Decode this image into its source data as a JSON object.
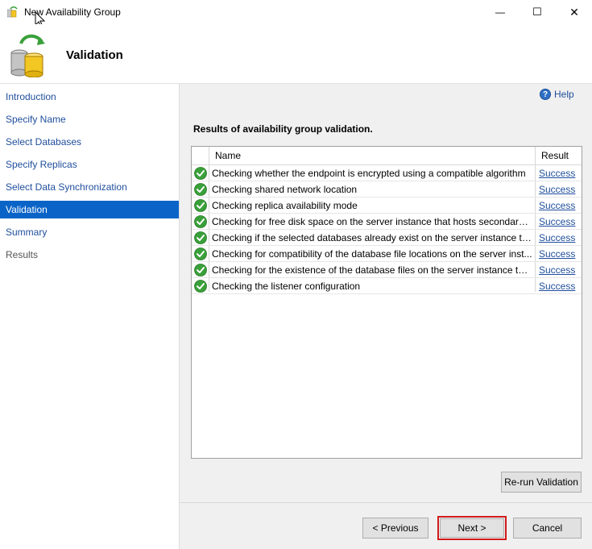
{
  "window": {
    "title": "New Availability Group",
    "minimize_symbol": "—",
    "maximize_symbol": "☐",
    "close_symbol": "✕"
  },
  "header": {
    "title": "Validation",
    "icon": "database-sync-icon"
  },
  "sidebar": {
    "items": [
      {
        "label": "Introduction",
        "state": "normal"
      },
      {
        "label": "Specify Name",
        "state": "normal"
      },
      {
        "label": "Select Databases",
        "state": "normal"
      },
      {
        "label": "Specify Replicas",
        "state": "normal"
      },
      {
        "label": "Select Data Synchronization",
        "state": "normal"
      },
      {
        "label": "Validation",
        "state": "selected"
      },
      {
        "label": "Summary",
        "state": "normal"
      },
      {
        "label": "Results",
        "state": "disabled"
      }
    ]
  },
  "main": {
    "help_label": "Help",
    "results_title": "Results of availability group validation.",
    "grid": {
      "columns": [
        "Name",
        "Result"
      ],
      "rows": [
        {
          "name": "Checking whether the endpoint is encrypted using a compatible algorithm",
          "result": "Success",
          "status_icon": "success-check-icon"
        },
        {
          "name": "Checking shared network location",
          "result": "Success",
          "status_icon": "success-check-icon"
        },
        {
          "name": "Checking replica availability mode",
          "result": "Success",
          "status_icon": "success-check-icon"
        },
        {
          "name": "Checking for free disk space on the server instance that hosts secondary r...",
          "result": "Success",
          "status_icon": "success-check-icon"
        },
        {
          "name": "Checking if the selected databases already exist on the server instance tha...",
          "result": "Success",
          "status_icon": "success-check-icon"
        },
        {
          "name": "Checking for compatibility of the database file locations on the server inst...",
          "result": "Success",
          "status_icon": "success-check-icon"
        },
        {
          "name": "Checking for the existence of the database files on the server instance tha...",
          "result": "Success",
          "status_icon": "success-check-icon"
        },
        {
          "name": "Checking the listener configuration",
          "result": "Success",
          "status_icon": "success-check-icon"
        }
      ]
    },
    "rerun_label": "Re-run Validation"
  },
  "footer": {
    "previous_label": "< Previous",
    "next_label": "Next >",
    "cancel_label": "Cancel"
  },
  "colors": {
    "link": "#1f4e9c",
    "selected_nav": "#0a64c8",
    "success": "#3aa03a",
    "highlight": "#d11b1b"
  }
}
